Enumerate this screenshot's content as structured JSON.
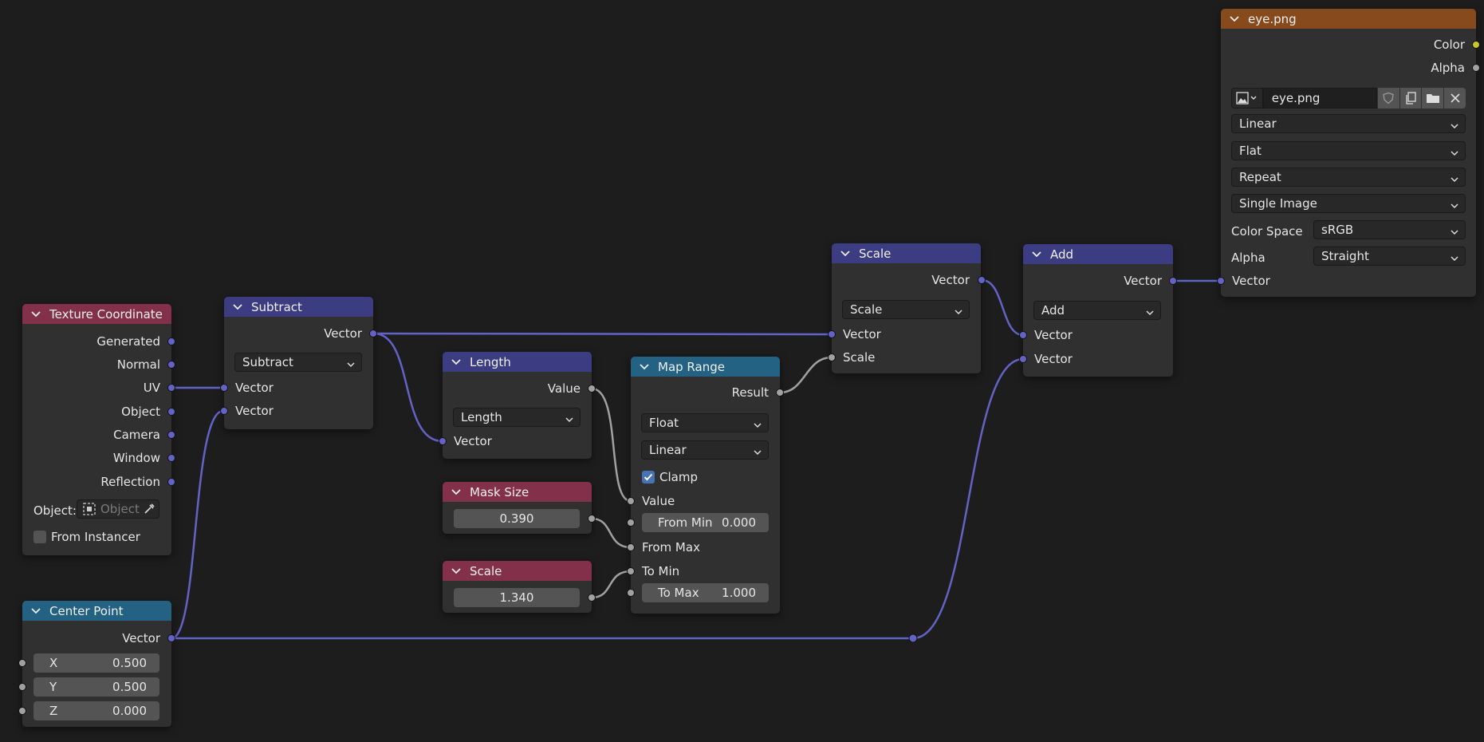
{
  "nodes": {
    "texture_coordinate": {
      "title": "Texture Coordinate",
      "outputs": [
        "Generated",
        "Normal",
        "UV",
        "Object",
        "Camera",
        "Window",
        "Reflection"
      ],
      "object_label": "Object:",
      "object_placeholder": "Object",
      "from_instancer": "From Instancer",
      "from_instancer_checked": false
    },
    "center_point": {
      "title": "Center Point",
      "output": "Vector",
      "fields": [
        {
          "label": "X",
          "value": "0.500"
        },
        {
          "label": "Y",
          "value": "0.500"
        },
        {
          "label": "Z",
          "value": "0.000"
        }
      ]
    },
    "subtract": {
      "title": "Subtract",
      "output": "Vector",
      "operation": "Subtract",
      "inputs": [
        "Vector",
        "Vector"
      ]
    },
    "length": {
      "title": "Length",
      "output": "Value",
      "operation": "Length",
      "input": "Vector"
    },
    "mask_size": {
      "title": "Mask Size",
      "value": "0.390"
    },
    "scale_value": {
      "title": "Scale",
      "value": "1.340"
    },
    "map_range": {
      "title": "Map Range",
      "output": "Result",
      "data_type": "Float",
      "interpolation": "Linear",
      "clamp_label": "Clamp",
      "clamp_checked": true,
      "value_label": "Value",
      "from_min_label": "From Min",
      "from_min_value": "0.000",
      "from_max_label": "From Max",
      "to_min_label": "To Min",
      "to_max_label": "To Max",
      "to_max_value": "1.000"
    },
    "scale_vec": {
      "title": "Scale",
      "output": "Vector",
      "operation": "Scale",
      "inputs": [
        "Vector",
        "Scale"
      ]
    },
    "add": {
      "title": "Add",
      "output": "Vector",
      "operation": "Add",
      "inputs": [
        "Vector",
        "Vector"
      ]
    },
    "image": {
      "title": "eye.png",
      "outputs": [
        "Color",
        "Alpha"
      ],
      "image_name": "eye.png",
      "interpolation": "Linear",
      "projection": "Flat",
      "extension": "Repeat",
      "source": "Single Image",
      "color_space_label": "Color Space",
      "color_space": "sRGB",
      "alpha_label": "Alpha",
      "alpha_mode": "Straight",
      "input": "Vector"
    }
  },
  "colors": {
    "background": "#1d1d1d",
    "node_body": "#303030",
    "header_vector": "#3c3c83",
    "header_texture": "#83314a",
    "header_converter": "#246283",
    "header_image": "#874a1c",
    "socket_vector": "#6363c7",
    "socket_float": "#a1a1a1",
    "socket_color": "#c7c729",
    "checkbox_on": "#4772b3"
  }
}
